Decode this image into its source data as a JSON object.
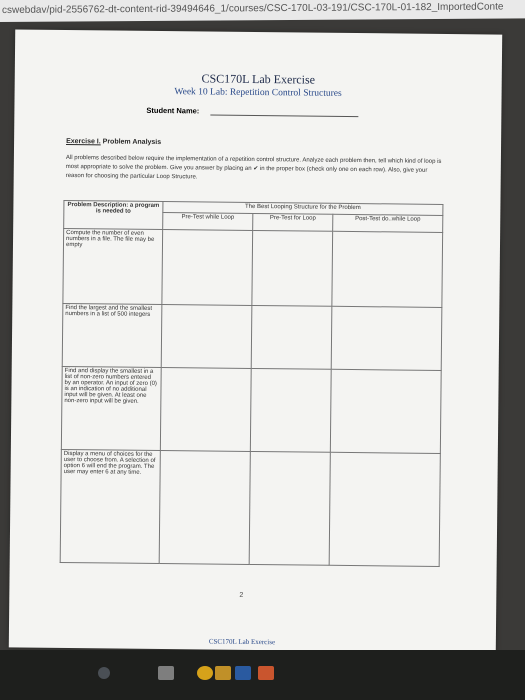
{
  "browser": {
    "url_text": "cswebdav/pid-2556762-dt-content-rid-39494646_1/courses/CSC-170L-03-191/CSC-170L-01-182_ImportedConte"
  },
  "document": {
    "title": "CSC170L Lab Exercise",
    "subtitle": "Week 10 Lab: Repetition Control Structures",
    "student_label": "Student Name:",
    "exercise_label": "Exercise I.",
    "exercise_title": "Problem Analysis",
    "instructions": "All problems described below require the implementation of a repetition control structure. Analyze each problem then, tell which kind of loop is most appropriate to solve the problem. Give you answer by placing an ✔ in the proper box (check only one on each row). Also, give your reason for choosing the particular Loop Structure.",
    "table": {
      "span_header": "The Best Looping Structure for the Problem",
      "desc_header": "Problem Description: a program is needed to",
      "columns": [
        "Pre-Test while Loop",
        "Pre-Test for Loop",
        "Post-Test do..while Loop"
      ],
      "rows": [
        "Compute the number of even numbers in a file. The file may be empty",
        "Find the largest and the smallest numbers in a list of 500 integers",
        "Find and display the smallest in a list of non-zero numbers entered by an operator. An input of zero (0) is an indication of no additional input will be given. At least one non-zero input will be given.",
        "Display a menu of choices for the user to choose from. A selection of option 6 will end the program. The user may enter 6 at any time."
      ]
    },
    "page_number": "2",
    "footer": "CSC170L Lab Exercise"
  },
  "icons": {
    "check": "check-icon",
    "taskbar": [
      "edge-icon",
      "store-icon",
      "chrome-icon",
      "folder-icon",
      "word-icon",
      "powerpoint-icon"
    ]
  }
}
